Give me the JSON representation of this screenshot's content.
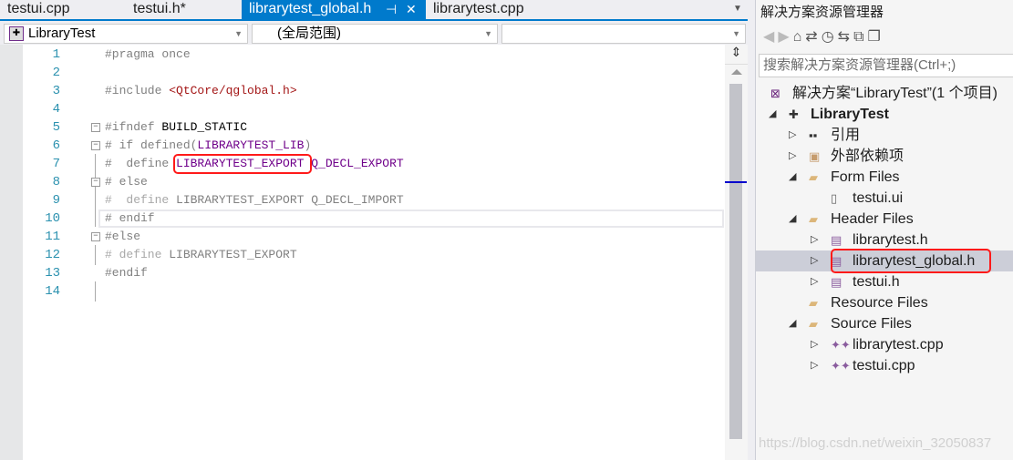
{
  "tabs": [
    {
      "label": "testui.cpp"
    },
    {
      "label": "testui.h*"
    },
    {
      "label": "librarytest_global.h",
      "active": true
    },
    {
      "label": "librarytest.cpp"
    }
  ],
  "navbar": {
    "project": "LibraryTest",
    "scope": "(全局范围)",
    "member": ""
  },
  "colors": {
    "accent": "#007acc",
    "line_number": "#2b91af",
    "macro": "#6f008a",
    "string": "#a31515",
    "highlight": "#ff1a1a"
  },
  "code": [
    {
      "n": "1",
      "tokens": [
        [
          "pp",
          "#pragma once"
        ]
      ]
    },
    {
      "n": "2",
      "tokens": []
    },
    {
      "n": "3",
      "tokens": [
        [
          "pp",
          "#include "
        ],
        [
          "str",
          "<QtCore/qglobal.h>"
        ]
      ]
    },
    {
      "n": "4",
      "tokens": []
    },
    {
      "n": "5",
      "fold": true,
      "tokens": [
        [
          "pp",
          "#ifndef "
        ],
        [
          "id",
          "BUILD_STATIC"
        ]
      ]
    },
    {
      "n": "6",
      "fold": true,
      "tokens": [
        [
          "pp",
          "# if defined("
        ],
        [
          "mac",
          "LIBRARYTEST_LIB"
        ],
        [
          "pp",
          ")"
        ]
      ]
    },
    {
      "n": "7",
      "tokens": [
        [
          "pp",
          "#  define "
        ],
        [
          "mac",
          "LIBRARYTEST_EXPORT"
        ],
        [
          "pp",
          " "
        ],
        [
          "mac",
          "Q_DECL_EXPORT"
        ]
      ]
    },
    {
      "n": "8",
      "fold": true,
      "tokens": [
        [
          "pp",
          "# else"
        ]
      ]
    },
    {
      "n": "9",
      "tokens": [
        [
          "dim",
          "#  define "
        ],
        [
          "dimid",
          "LIBRARYTEST_EXPORT Q_DECL_IMPORT"
        ]
      ]
    },
    {
      "n": "10",
      "current": true,
      "tokens": [
        [
          "pp",
          "# endif"
        ]
      ]
    },
    {
      "n": "11",
      "fold": true,
      "tokens": [
        [
          "pp",
          "#else"
        ]
      ]
    },
    {
      "n": "12",
      "tokens": [
        [
          "dim",
          "# define "
        ],
        [
          "dimid",
          "LIBRARYTEST_EXPORT"
        ]
      ]
    },
    {
      "n": "13",
      "tokens": [
        [
          "pp",
          "#endif"
        ]
      ]
    },
    {
      "n": "14",
      "tokens": []
    }
  ],
  "solution_explorer": {
    "title": "解决方案资源管理器",
    "search_placeholder": "搜索解决方案资源管理器(Ctrl+;)",
    "toolbar_icons": [
      "back-icon",
      "forward-icon",
      "home-icon",
      "sync-icon",
      "history-icon",
      "switch-views-icon",
      "collapse-all-icon",
      "copy-icon"
    ],
    "tree": [
      {
        "label": "解决方案“LibraryTest”(1 个项目)",
        "icon": "solution-icon",
        "level": 0
      },
      {
        "label": "LibraryTest",
        "icon": "project-icon",
        "level": 0,
        "expanded": true,
        "bold": true
      },
      {
        "label": "引用",
        "icon": "references-icon",
        "level": 1,
        "collapsed": true
      },
      {
        "label": "外部依赖项",
        "icon": "external-deps-icon",
        "level": 1,
        "collapsed": true
      },
      {
        "label": "Form Files",
        "icon": "folder-icon",
        "level": 1,
        "expanded": true
      },
      {
        "label": "testui.ui",
        "icon": "file-icon",
        "level": 2
      },
      {
        "label": "Header Files",
        "icon": "folder-icon",
        "level": 1,
        "expanded": true
      },
      {
        "label": "librarytest.h",
        "icon": "header-file-icon",
        "level": 2,
        "collapsed": true
      },
      {
        "label": "librarytest_global.h",
        "icon": "header-file-icon",
        "level": 2,
        "collapsed": true,
        "selected": true
      },
      {
        "label": "testui.h",
        "icon": "header-file-icon",
        "level": 2,
        "collapsed": true
      },
      {
        "label": "Resource Files",
        "icon": "folder-icon",
        "level": 1
      },
      {
        "label": "Source Files",
        "icon": "folder-icon",
        "level": 1,
        "expanded": true
      },
      {
        "label": "librarytest.cpp",
        "icon": "cpp-file-icon",
        "level": 2,
        "collapsed": true
      },
      {
        "label": "testui.cpp",
        "icon": "cpp-file-icon",
        "level": 2,
        "collapsed": true
      }
    ]
  },
  "watermark": "https://blog.csdn.net/weixin_32050837"
}
